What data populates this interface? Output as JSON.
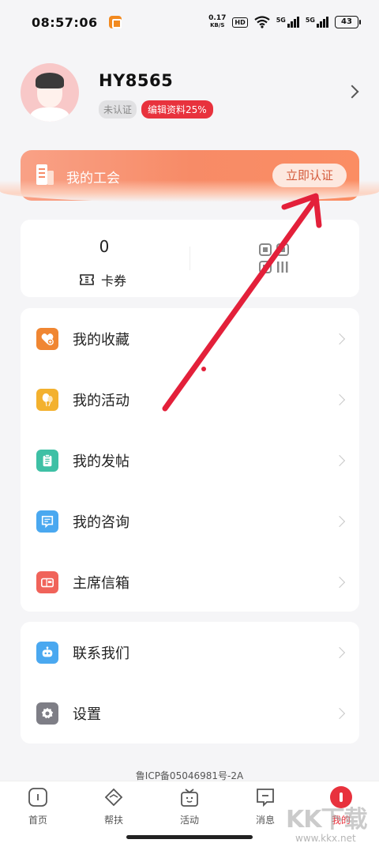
{
  "status_bar": {
    "time": "08:57:06",
    "speed_value": "0.17",
    "speed_unit": "KB/S",
    "hd": "HD",
    "sim1": "5G",
    "sim2": "5G",
    "battery": "43"
  },
  "profile": {
    "username": "HY8565",
    "badge_unverified": "未认证",
    "badge_edit": "编辑资料25%"
  },
  "union": {
    "title": "我的工会",
    "certify_button": "立即认证"
  },
  "coupon": {
    "count": "0",
    "label": "卡券"
  },
  "menu": {
    "items": [
      {
        "label": "我的收藏",
        "icon": "heart-plus-icon",
        "color": "#f08632"
      },
      {
        "label": "我的活动",
        "icon": "balloon-icon",
        "color": "#f3b12e"
      },
      {
        "label": "我的发帖",
        "icon": "clipboard-icon",
        "color": "#3ec0a5"
      },
      {
        "label": "我的咨询",
        "icon": "chat-icon",
        "color": "#4aa8f0"
      },
      {
        "label": "主席信箱",
        "icon": "mailbox-icon",
        "color": "#f0635a"
      }
    ],
    "secondary": [
      {
        "label": "联系我们",
        "icon": "robot-icon",
        "color": "#4aa8f0"
      },
      {
        "label": "设置",
        "icon": "gear-icon",
        "color": "#7e7e86"
      }
    ]
  },
  "footer": {
    "icp": "鲁ICP备05046981号-2A"
  },
  "tabs": [
    {
      "label": "首页",
      "icon": "home-icon"
    },
    {
      "label": "帮扶",
      "icon": "handshake-icon"
    },
    {
      "label": "活动",
      "icon": "gift-box-icon"
    },
    {
      "label": "消息",
      "icon": "message-icon"
    },
    {
      "label": "我的",
      "icon": "profile-icon",
      "active": true
    }
  ],
  "watermark": {
    "text": "KK下载",
    "url": "www.kkx.net"
  },
  "colors": {
    "accent_red": "#e8323d",
    "banner_orange": "#f78b67",
    "arrow_red": "#e3203a"
  }
}
